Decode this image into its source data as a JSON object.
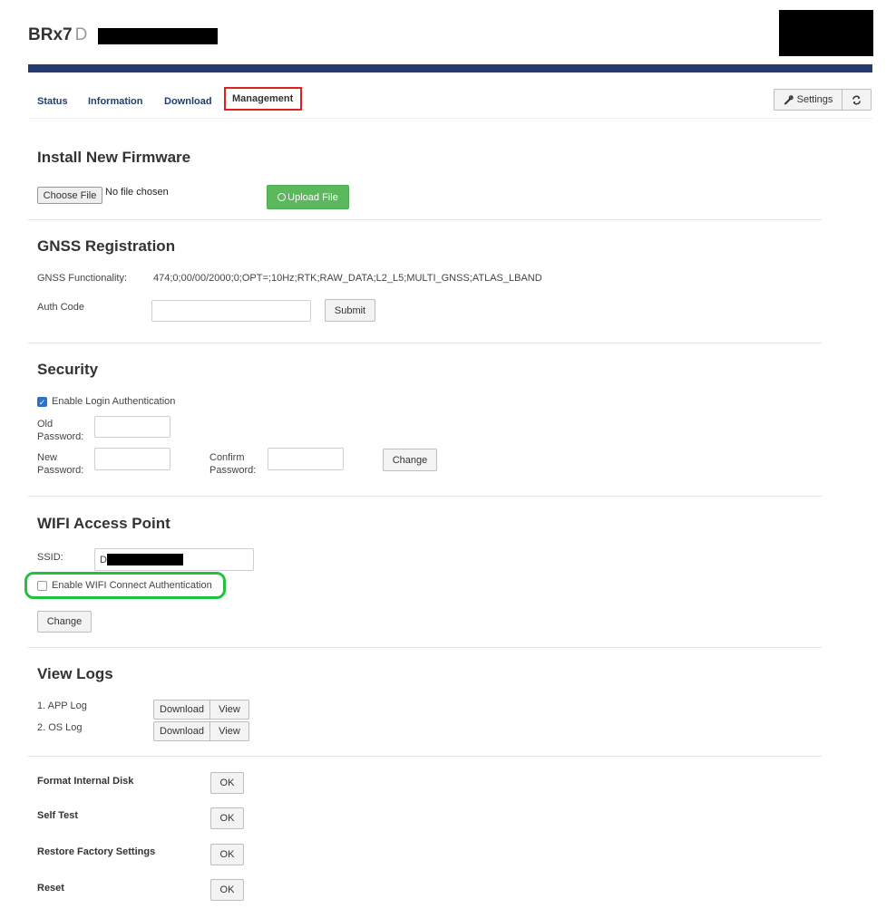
{
  "header": {
    "title": "BRx7",
    "title_suffix": "D"
  },
  "nav": {
    "tabs": [
      {
        "label": "Status"
      },
      {
        "label": "Information"
      },
      {
        "label": "Download"
      },
      {
        "label": "Management",
        "active": true
      }
    ],
    "settings_label": "Settings"
  },
  "firmware": {
    "heading": "Install New Firmware",
    "choose_file_label": "Choose File",
    "file_status": "No file chosen",
    "upload_label": "Upload File"
  },
  "gnss": {
    "heading": "GNSS Registration",
    "functionality_label": "GNSS Functionality:",
    "functionality_value": "474;0;00/00/2000;0;OPT=;10Hz;RTK;RAW_DATA;L2_L5;MULTI_GNSS;ATLAS_LBAND",
    "auth_code_label": "Auth Code",
    "auth_code_value": "",
    "submit_label": "Submit"
  },
  "security": {
    "heading": "Security",
    "enable_login_label": "Enable Login Authentication",
    "enable_login_checked": true,
    "old_password_label_1": "Old",
    "old_password_label_2": "Password:",
    "new_password_label_1": "New",
    "new_password_label_2": "Password:",
    "confirm_password_label_1": "Confirm",
    "confirm_password_label_2": "Password:",
    "change_label": "Change"
  },
  "wifi": {
    "heading": "WIFI Access Point",
    "ssid_label": "SSID:",
    "ssid_value": "D",
    "enable_auth_label": "Enable WIFI Connect Authentication",
    "enable_auth_checked": false,
    "change_label": "Change"
  },
  "logs": {
    "heading": "View Logs",
    "items": [
      {
        "label": "1. APP Log",
        "download_label": "Download",
        "view_label": "View"
      },
      {
        "label": "2. OS Log",
        "download_label": "Download",
        "view_label": "View"
      }
    ]
  },
  "actions": [
    {
      "label": "Format Internal Disk",
      "button": "OK"
    },
    {
      "label": "Self Test",
      "button": "OK"
    },
    {
      "label": "Restore Factory Settings",
      "button": "OK"
    },
    {
      "label": "Reset",
      "button": "OK"
    }
  ],
  "colors": {
    "accent_bar": "#243a71",
    "tab_link": "#1f3f6e",
    "active_tab_outline": "#e0201f",
    "upload_button": "#5cb85c",
    "highlight_outline": "#21c240",
    "checkbox_checked": "#2a73c9"
  }
}
